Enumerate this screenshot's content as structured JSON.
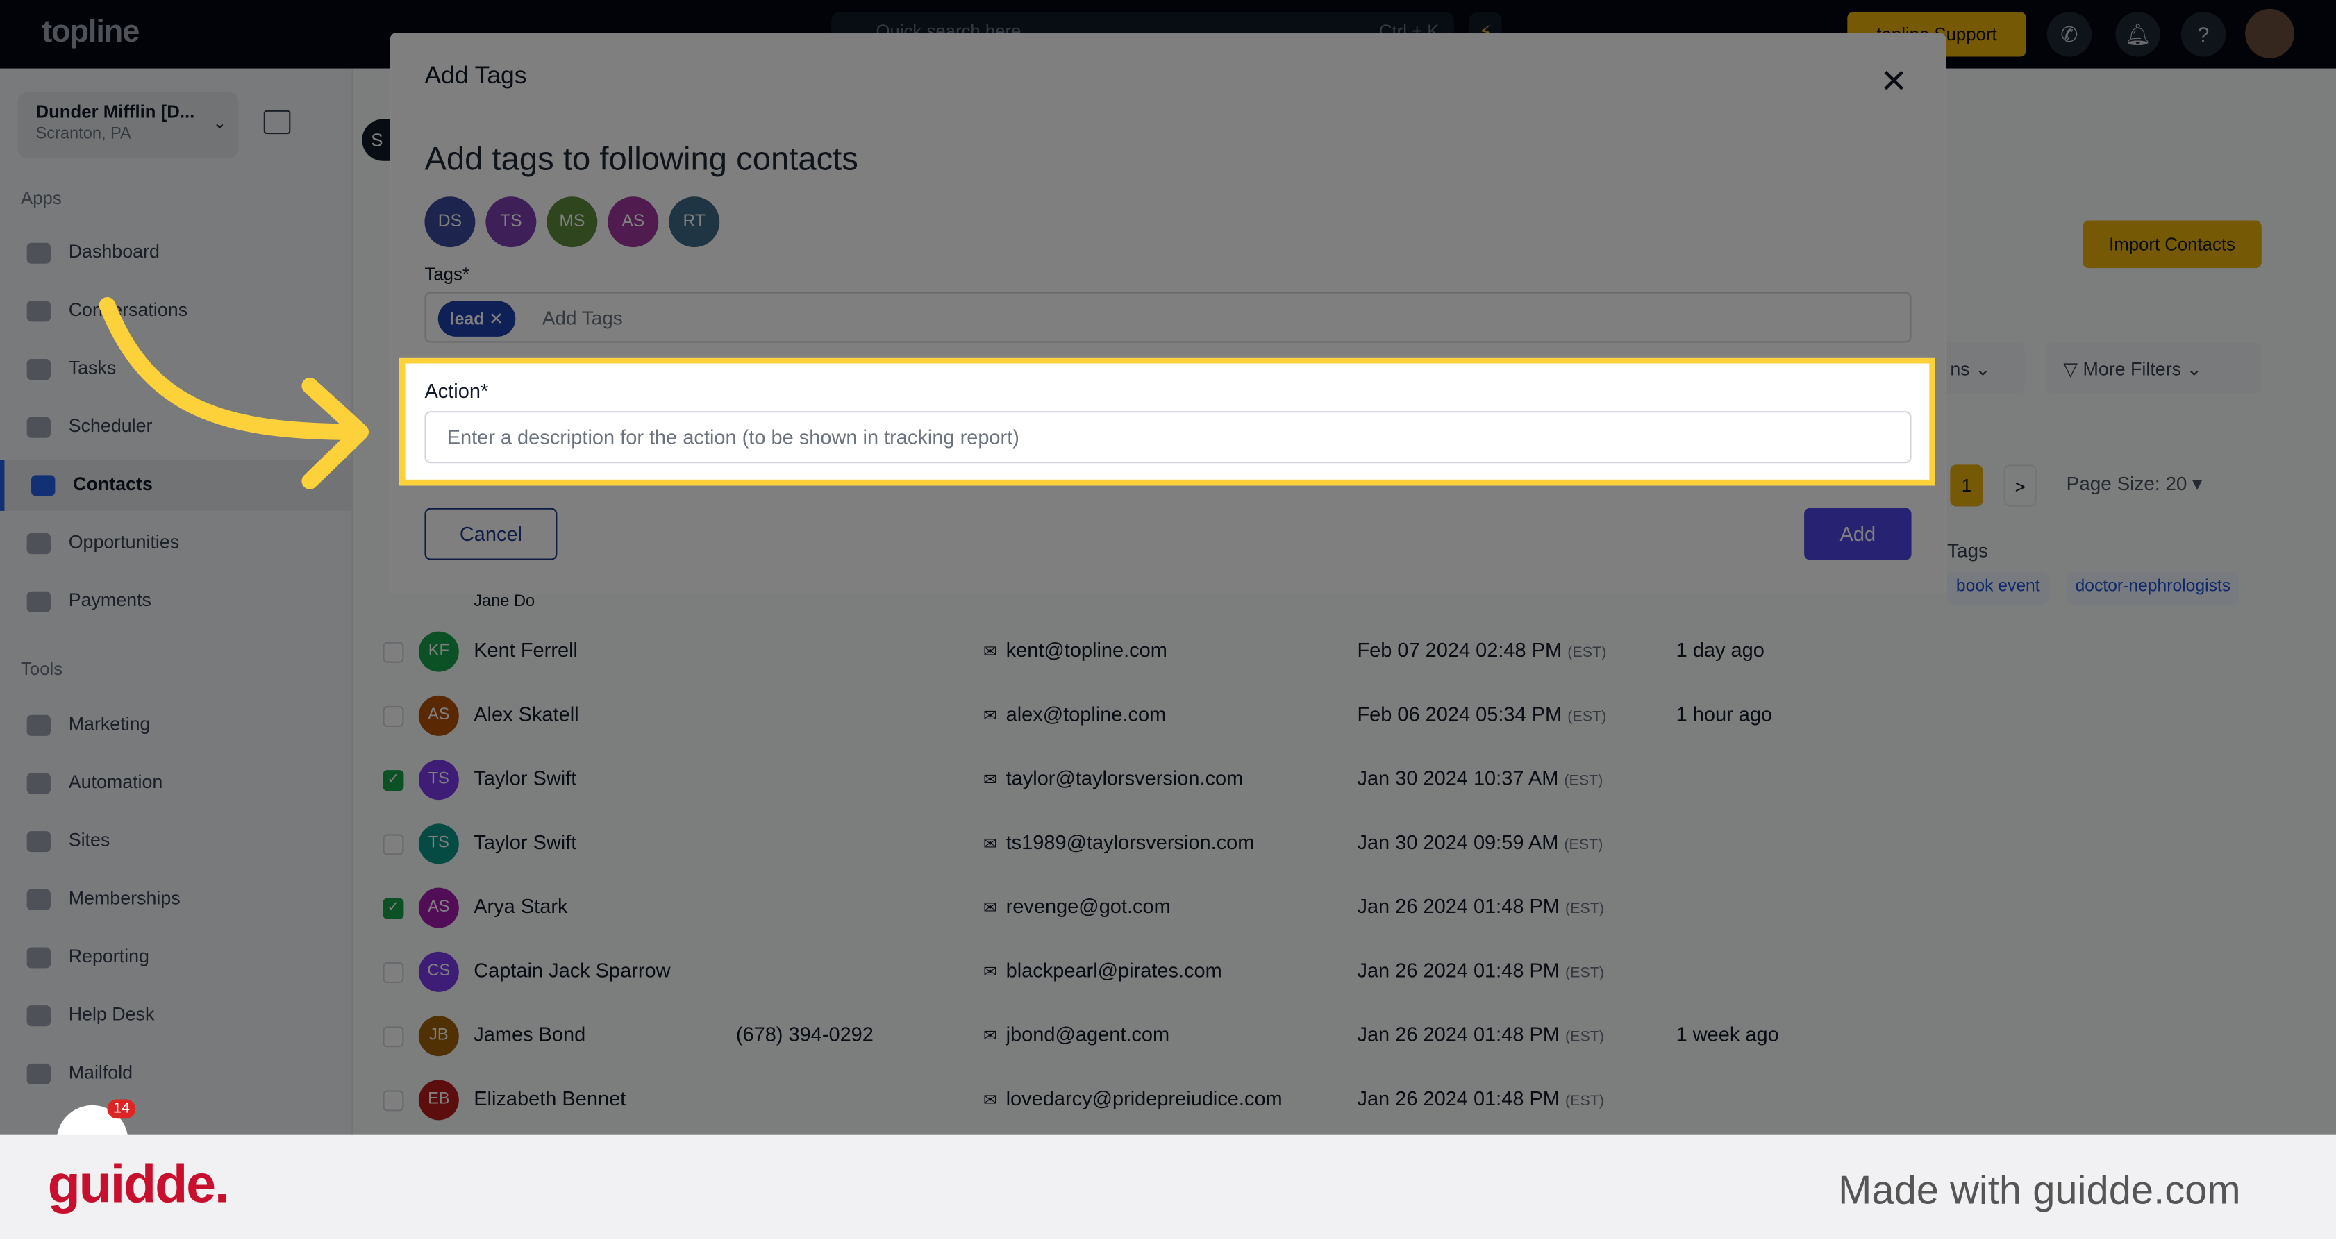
{
  "topbar": {
    "logo": "topline",
    "search_placeholder": "Quick search here",
    "search_shortcut": "Ctrl + K",
    "support_label": "topline Support"
  },
  "sidebar": {
    "account_name": "Dunder Mifflin [D...",
    "account_location": "Scranton, PA",
    "apps_heading": "Apps",
    "tools_heading": "Tools",
    "apps": [
      {
        "label": "Dashboard"
      },
      {
        "label": "Conversations"
      },
      {
        "label": "Tasks"
      },
      {
        "label": "Scheduler"
      },
      {
        "label": "Contacts",
        "active": true
      },
      {
        "label": "Opportunities"
      },
      {
        "label": "Payments"
      }
    ],
    "tools": [
      {
        "label": "Marketing"
      },
      {
        "label": "Automation"
      },
      {
        "label": "Sites"
      },
      {
        "label": "Memberships"
      },
      {
        "label": "Reporting"
      },
      {
        "label": "Help Desk"
      },
      {
        "label": "Mailfold"
      }
    ],
    "notification_count": "14"
  },
  "main": {
    "pill_label": "S",
    "import_label": "Import Contacts",
    "columns_label": "ns",
    "more_filters_label": "More Filters",
    "page_current": "1",
    "page_next": ">",
    "page_size": "Page Size: 20",
    "tags_header": "Tags",
    "tag_chips": [
      "book event",
      "doctor-nephrologists"
    ],
    "partial_row_name": "Jane Do",
    "rows": [
      {
        "initials": "KF",
        "name": "Kent Ferrell",
        "phone": "",
        "email": "kent@topline.com",
        "date": "Feb 07 2024 02:48 PM",
        "tz": "(EST)",
        "activity": "1 day ago",
        "checked": false,
        "color": "#16a34a"
      },
      {
        "initials": "AS",
        "name": "Alex Skatell",
        "phone": "",
        "email": "alex@topline.com",
        "date": "Feb 06 2024 05:34 PM",
        "tz": "(EST)",
        "activity": "1 hour ago",
        "checked": false,
        "color": "#b45309"
      },
      {
        "initials": "TS",
        "name": "Taylor Swift",
        "phone": "",
        "email": "taylor@taylorsversion.com",
        "date": "Jan 30 2024 10:37 AM",
        "tz": "(EST)",
        "activity": "",
        "checked": true,
        "color": "#7c3aed"
      },
      {
        "initials": "TS",
        "name": "Taylor Swift",
        "phone": "",
        "email": "ts1989@taylorsversion.com",
        "date": "Jan 30 2024 09:59 AM",
        "tz": "(EST)",
        "activity": "",
        "checked": false,
        "color": "#0d9488"
      },
      {
        "initials": "AS",
        "name": "Arya Stark",
        "phone": "",
        "email": "revenge@got.com",
        "date": "Jan 26 2024 01:48 PM",
        "tz": "(EST)",
        "activity": "",
        "checked": true,
        "color": "#a21caf"
      },
      {
        "initials": "CS",
        "name": "Captain Jack Sparrow",
        "phone": "",
        "email": "blackpearl@pirates.com",
        "date": "Jan 26 2024 01:48 PM",
        "tz": "(EST)",
        "activity": "",
        "checked": false,
        "color": "#7c3aed"
      },
      {
        "initials": "JB",
        "name": "James Bond",
        "phone": "(678) 394-0292",
        "email": "jbond@agent.com",
        "date": "Jan 26 2024 01:48 PM",
        "tz": "(EST)",
        "activity": "1 week ago",
        "checked": false,
        "color": "#a16207"
      },
      {
        "initials": "EB",
        "name": "Elizabeth Bennet",
        "phone": "",
        "email": "lovedarcy@pridepreiudice.com",
        "date": "Jan 26 2024 01:48 PM",
        "tz": "(EST)",
        "activity": "",
        "checked": false,
        "color": "#b91c1c"
      }
    ]
  },
  "modal": {
    "title": "Add Tags",
    "subtitle": "Add tags to following contacts",
    "contacts": [
      {
        "initials": "DS",
        "color": "#3b4a9e"
      },
      {
        "initials": "TS",
        "color": "#7e3fb0"
      },
      {
        "initials": "MS",
        "color": "#5c8a3a"
      },
      {
        "initials": "AS",
        "color": "#a0379c"
      },
      {
        "initials": "RT",
        "color": "#3f6b86"
      }
    ],
    "tags_label": "Tags*",
    "tags": [
      "lead"
    ],
    "tags_placeholder": "Add Tags",
    "action_label": "Action*",
    "action_placeholder": "Enter a description for the action (to be shown in tracking report)",
    "action_value": "",
    "cancel_label": "Cancel",
    "add_label": "Add"
  },
  "footer": {
    "logo": "guidde.",
    "tagline": "Made with guidde.com"
  },
  "colors": {
    "highlight": "#fdd13a",
    "primary": "#4f46e5",
    "accent": "#eab308",
    "brand_red": "#c8102e"
  }
}
